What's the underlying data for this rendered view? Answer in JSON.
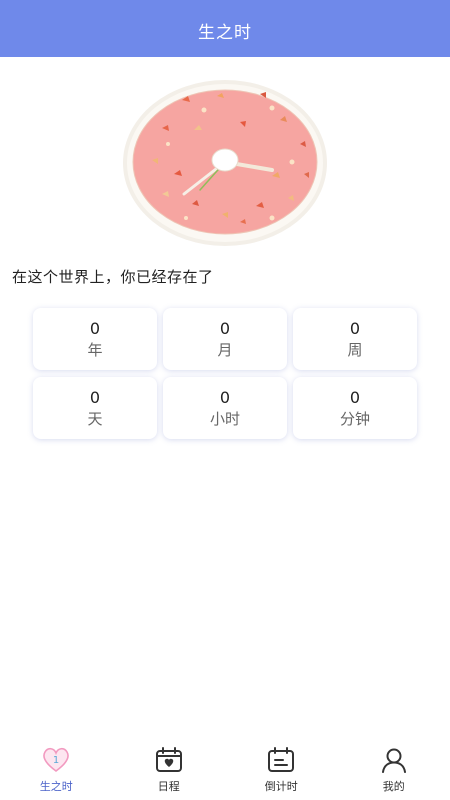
{
  "header": {
    "title": "生之时"
  },
  "intro": "在这个世界上，你已经存在了",
  "stats": [
    {
      "value": "0",
      "unit": "年"
    },
    {
      "value": "0",
      "unit": "月"
    },
    {
      "value": "0",
      "unit": "周"
    },
    {
      "value": "0",
      "unit": "天"
    },
    {
      "value": "0",
      "unit": "小时"
    },
    {
      "value": "0",
      "unit": "分钟"
    }
  ],
  "tabbar": {
    "active_badge": "1",
    "items": [
      {
        "label": "生之时",
        "icon": "heart-icon",
        "active": true
      },
      {
        "label": "日程",
        "icon": "calendar-heart-icon",
        "active": false
      },
      {
        "label": "倒计时",
        "icon": "calendar-countdown-icon",
        "active": false
      },
      {
        "label": "我的",
        "icon": "user-icon",
        "active": false
      }
    ]
  },
  "colors": {
    "header": "#6f89ea",
    "active_tab": "#4c63c9",
    "clock_face": "#f6a5a1"
  }
}
